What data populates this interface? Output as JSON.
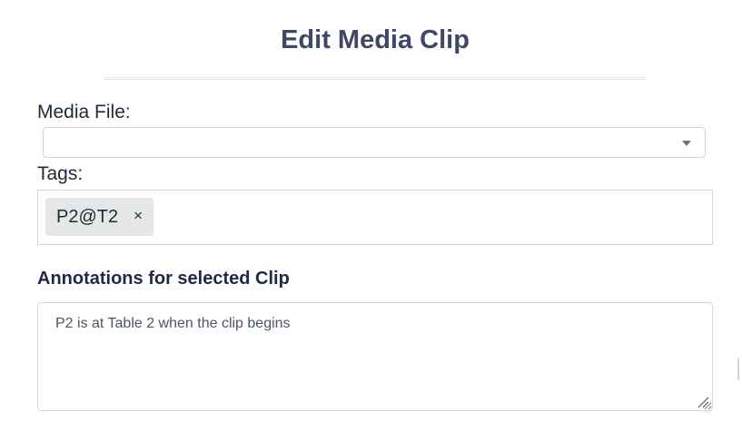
{
  "page": {
    "title": "Edit Media Clip"
  },
  "media_file": {
    "label": "Media File:",
    "selected_value": ""
  },
  "tags": {
    "label": "Tags:",
    "items": [
      {
        "text": "P2@T2",
        "remove_glyph": "×"
      }
    ]
  },
  "annotations": {
    "heading": "Annotations for selected Clip",
    "value": "P2 is at Table 2 when the clip begins"
  },
  "icons": {
    "dropdown": "chevron-down-icon",
    "tag_remove": "close-icon",
    "resize": "resize-grip-icon"
  },
  "colors": {
    "title": "#3f4766",
    "heading": "#1e2a45",
    "tag_background": "#e5e7e6",
    "border": "#d4d8dd"
  }
}
